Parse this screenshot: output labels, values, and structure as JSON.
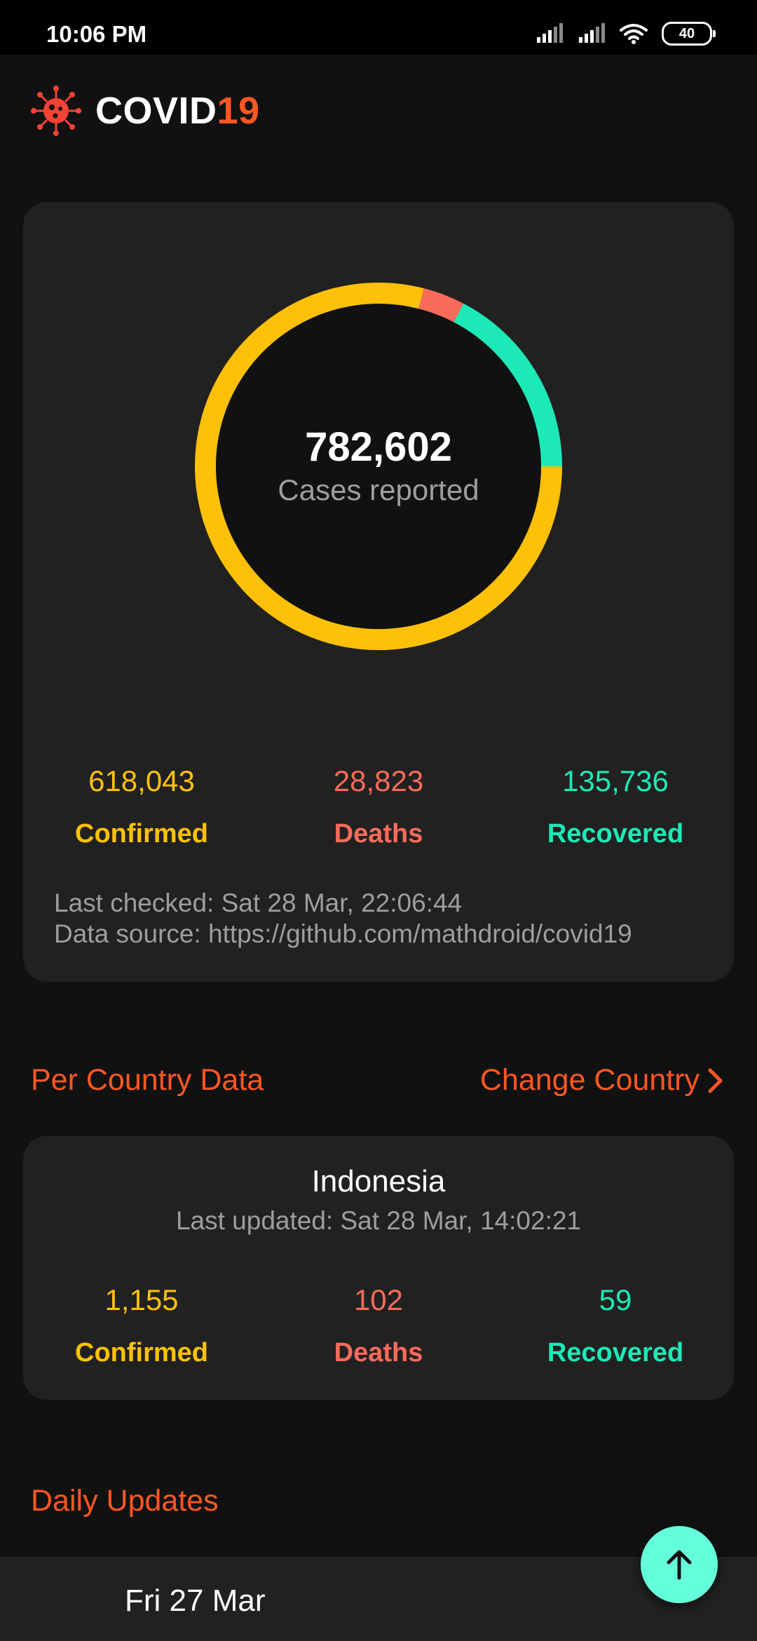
{
  "status_bar": {
    "time": "10:06 PM",
    "battery": "40",
    "icons": [
      "signal-icon",
      "signal-icon",
      "wifi-icon",
      "battery-icon"
    ]
  },
  "header": {
    "title_main": "COVID",
    "title_accent": "19",
    "logo_icon": "virus-icon"
  },
  "summary": {
    "total_value": "782,602",
    "total_label": "Cases reported",
    "confirmed_value": "618,043",
    "confirmed_label": "Confirmed",
    "deaths_value": "28,823",
    "deaths_label": "Deaths",
    "recovered_value": "135,736",
    "recovered_label": "Recovered",
    "last_checked": "Last checked: Sat 28 Mar, 22:06:44",
    "data_source": "Data source: https://github.com/mathdroid/covid19"
  },
  "chart_data": {
    "type": "pie",
    "categories": [
      "Confirmed",
      "Deaths",
      "Recovered"
    ],
    "values": [
      618043,
      28823,
      135736
    ],
    "colors": [
      "#ffc107",
      "#fa6b5a",
      "#1de9b6"
    ],
    "title": "",
    "xlabel": "",
    "ylabel": ""
  },
  "per_country": {
    "section_title": "Per Country Data",
    "change_country_label": "Change Country",
    "country": "Indonesia",
    "last_updated": "Last updated: Sat 28 Mar, 14:02:21",
    "confirmed_value": "1,155",
    "confirmed_label": "Confirmed",
    "deaths_value": "102",
    "deaths_label": "Deaths",
    "recovered_value": "59",
    "recovered_label": "Recovered"
  },
  "daily": {
    "section_title": "Daily Updates",
    "first_date": "Fri 27 Mar"
  },
  "colors": {
    "accent": "#ff5722",
    "confirmed": "#ffc107",
    "deaths": "#fa6b5a",
    "recovered": "#1de9b6",
    "fab": "#64ffda"
  }
}
